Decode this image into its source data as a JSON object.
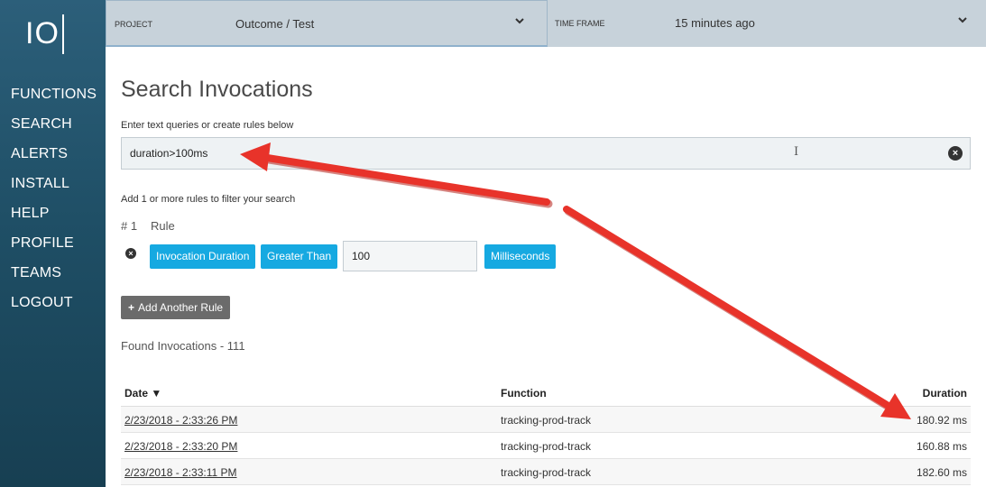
{
  "logo": {
    "text": "IO"
  },
  "sidebar": {
    "items": [
      {
        "label": "FUNCTIONS"
      },
      {
        "label": "SEARCH"
      },
      {
        "label": "ALERTS"
      },
      {
        "label": "INSTALL"
      },
      {
        "label": "HELP"
      },
      {
        "label": "PROFILE"
      },
      {
        "label": "TEAMS"
      },
      {
        "label": "LOGOUT"
      }
    ]
  },
  "topbar": {
    "project_label": "PROJECT",
    "project_value": "Outcome / Test",
    "timeframe_label": "TIME FRAME",
    "timeframe_value": "15 minutes ago",
    "chevron_icon": "chevron-down-icon"
  },
  "main": {
    "title": "Search Invocations",
    "search_hint": "Enter text queries or create rules below",
    "search_value": "duration>100ms",
    "clear_icon": "clear-icon",
    "rules_hint": "Add 1 or more rules to filter your search",
    "rule": {
      "number": "# 1",
      "word": "Rule",
      "field": "Invocation Duration",
      "operator": "Greater Than",
      "value": "100",
      "unit": "Milliseconds"
    },
    "add_rule_label": "Add Another Rule",
    "found_label": "Found Invocations - 111"
  },
  "table": {
    "headers": {
      "date": "Date ▼",
      "function": "Function",
      "duration": "Duration"
    },
    "rows": [
      {
        "date": "2/23/2018 - 2:33:26 PM",
        "function": "tracking-prod-track",
        "duration": "180.92 ms"
      },
      {
        "date": "2/23/2018 - 2:33:20 PM",
        "function": "tracking-prod-track",
        "duration": "160.88 ms"
      },
      {
        "date": "2/23/2018 - 2:33:11 PM",
        "function": "tracking-prod-track",
        "duration": "182.60 ms"
      }
    ]
  },
  "colors": {
    "sidebar_bg": "#1f4f66",
    "topbar_bg": "#c7d2da",
    "chip_blue": "#16a9e1",
    "button_gray": "#6b6b6b",
    "arrow_red": "#e8332a"
  }
}
